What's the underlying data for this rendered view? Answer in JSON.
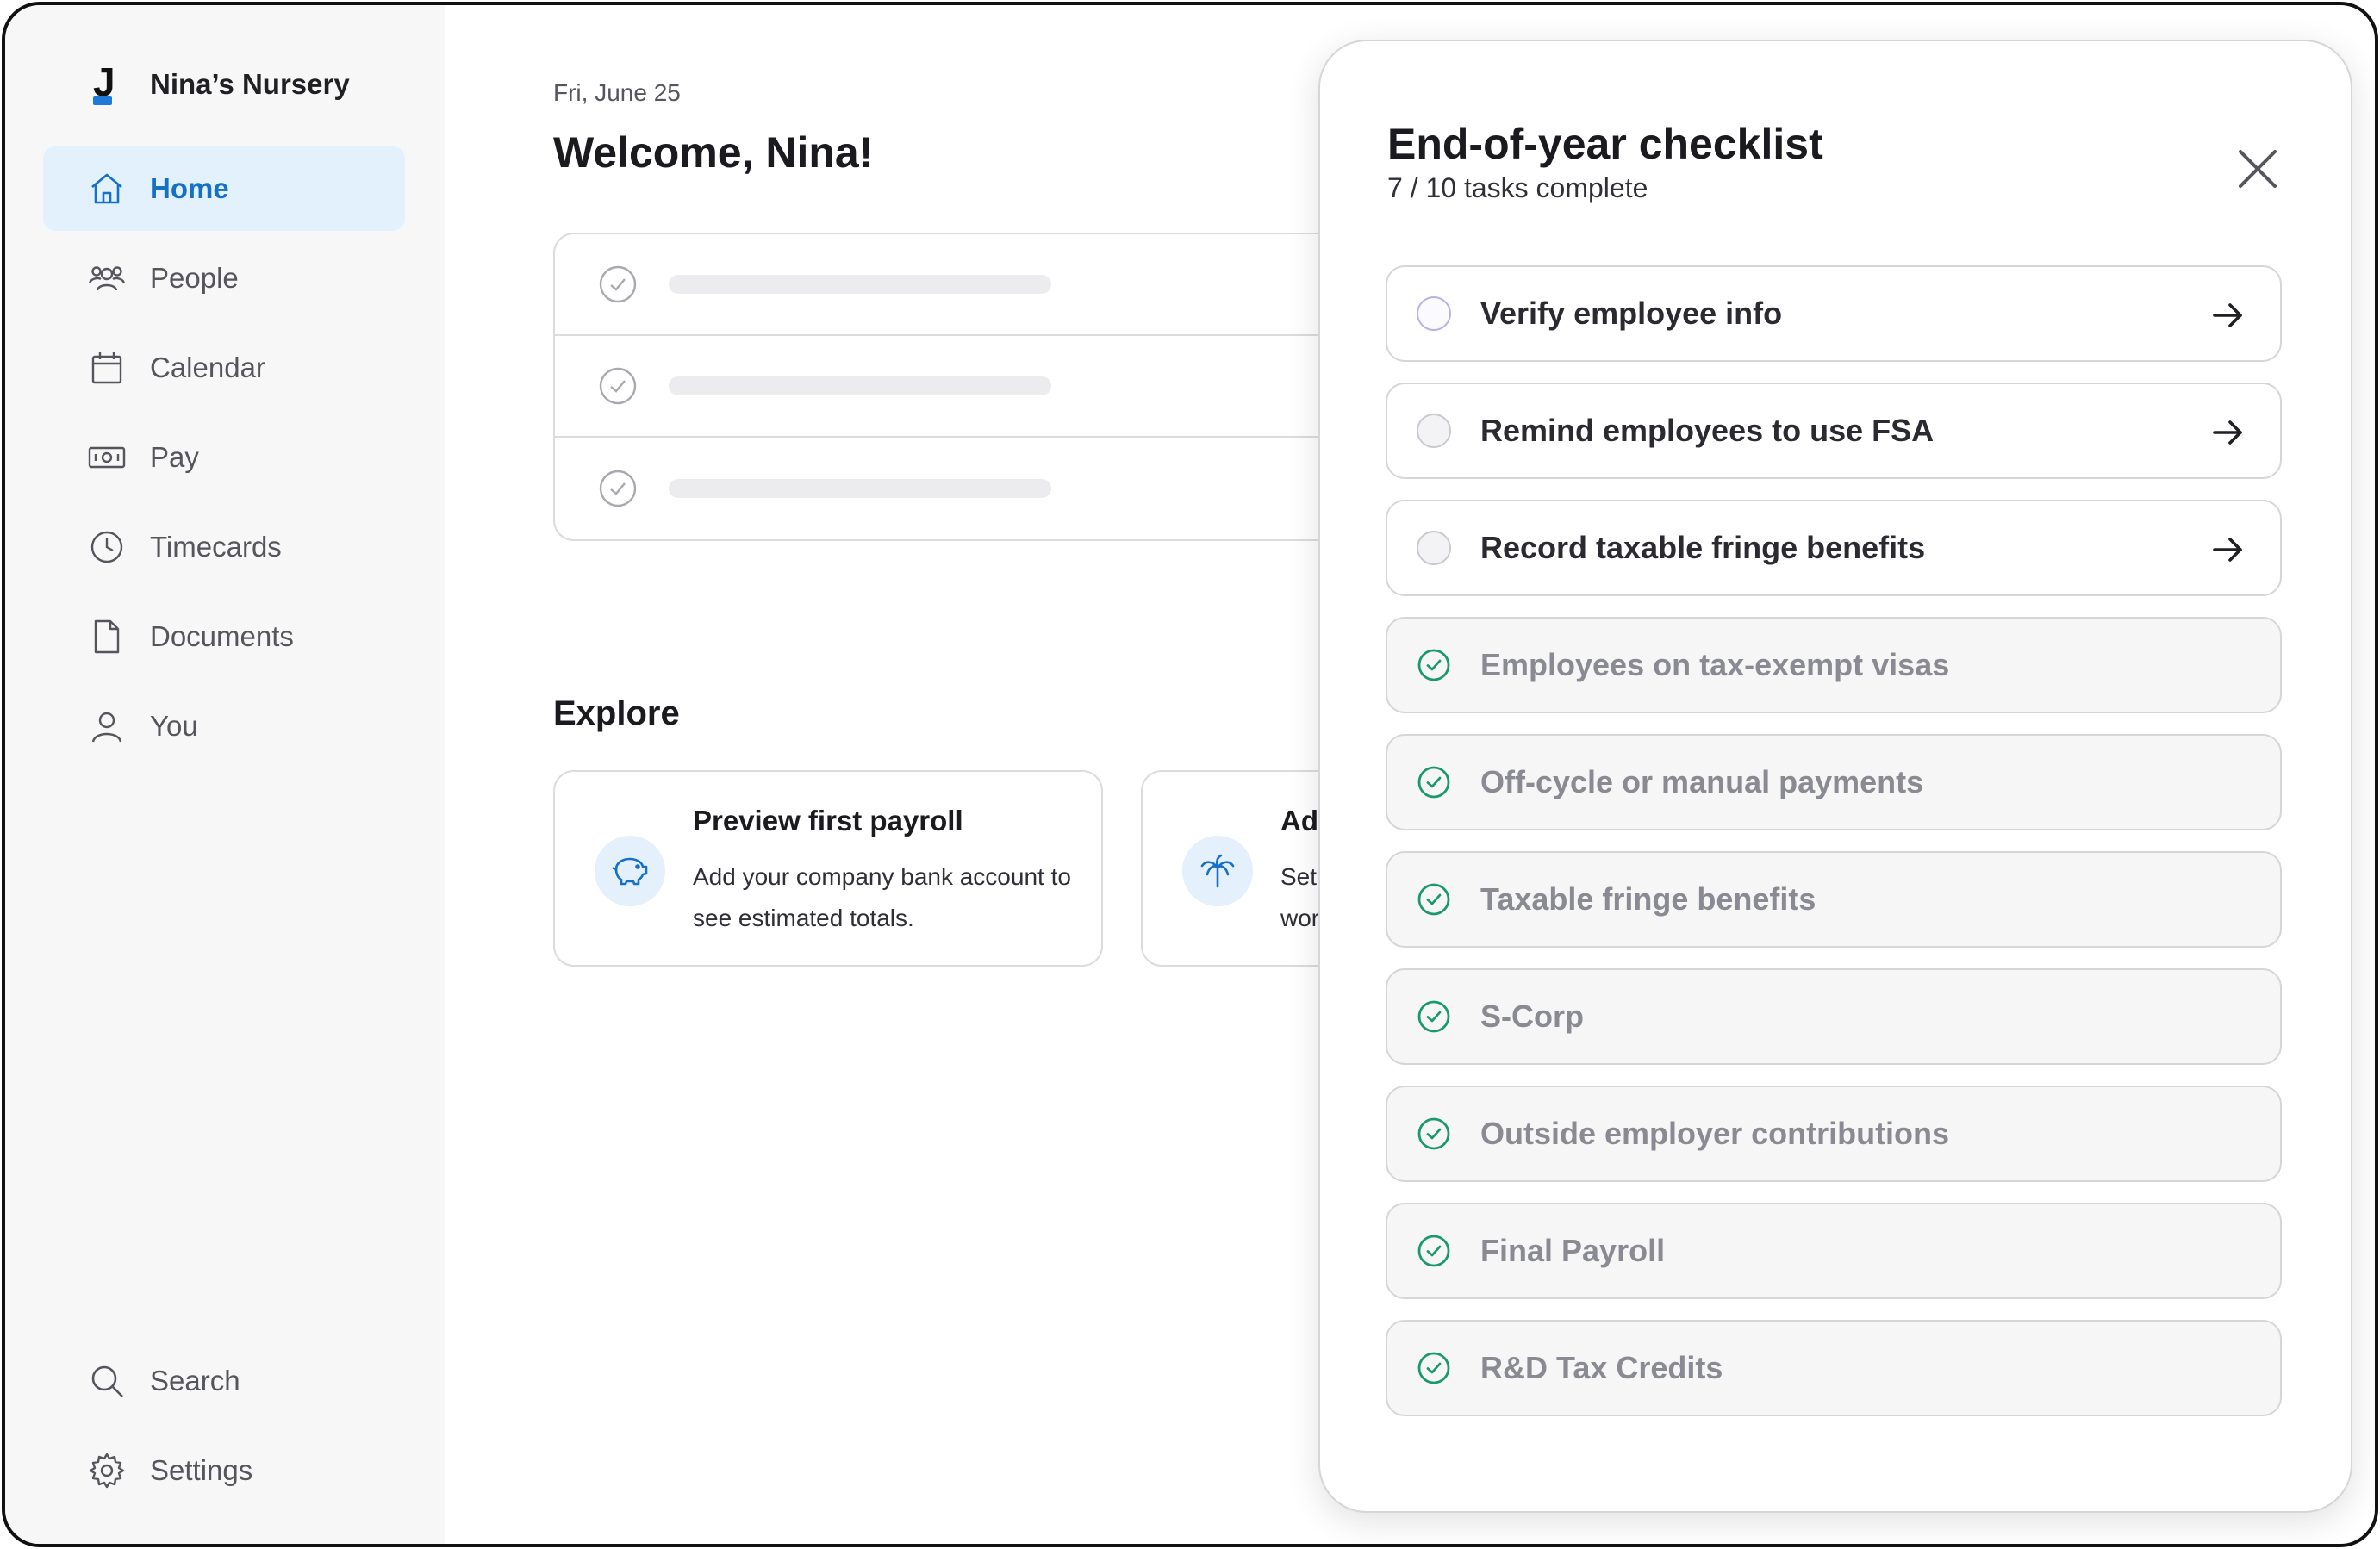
{
  "brand": {
    "name": "Nina’s Nursery"
  },
  "sidebar": {
    "items": [
      {
        "label": "Home",
        "icon": "home-icon",
        "active": true
      },
      {
        "label": "People",
        "icon": "people-icon"
      },
      {
        "label": "Calendar",
        "icon": "calendar-icon"
      },
      {
        "label": "Pay",
        "icon": "pay-icon"
      },
      {
        "label": "Timecards",
        "icon": "clock-icon"
      },
      {
        "label": "Documents",
        "icon": "document-icon"
      },
      {
        "label": "You",
        "icon": "user-icon"
      }
    ],
    "bottom": [
      {
        "label": "Search",
        "icon": "search-icon"
      },
      {
        "label": "Settings",
        "icon": "gear-icon"
      }
    ]
  },
  "main": {
    "date": "Fri, June 25",
    "welcome": "Welcome, Nina!",
    "explore_title": "Explore",
    "cards": [
      {
        "title": "Preview first payroll",
        "description": "Add your company bank account to see estimated totals.",
        "icon": "piggy-bank-icon"
      },
      {
        "title": "Ad",
        "description": "Set wor",
        "icon": "palm-tree-icon"
      }
    ]
  },
  "drawer": {
    "title": "End-of-year checklist",
    "progress": "7 / 10 tasks complete",
    "items": [
      {
        "label": "Verify employee info",
        "done": false
      },
      {
        "label": "Remind employees to use FSA",
        "done": false
      },
      {
        "label": "Record taxable fringe benefits",
        "done": false
      },
      {
        "label": "Employees on tax-exempt visas",
        "done": true
      },
      {
        "label": "Off-cycle or manual payments",
        "done": true
      },
      {
        "label": "Taxable fringe benefits",
        "done": true
      },
      {
        "label": "S-Corp",
        "done": true
      },
      {
        "label": "Outside employer contributions",
        "done": true
      },
      {
        "label": "Final Payroll",
        "done": true
      },
      {
        "label": "R&D Tax Credits",
        "done": true
      }
    ]
  },
  "colors": {
    "accent": "#1570c8",
    "active_bg": "#e3f1fd",
    "success": "#1a9a6c"
  }
}
